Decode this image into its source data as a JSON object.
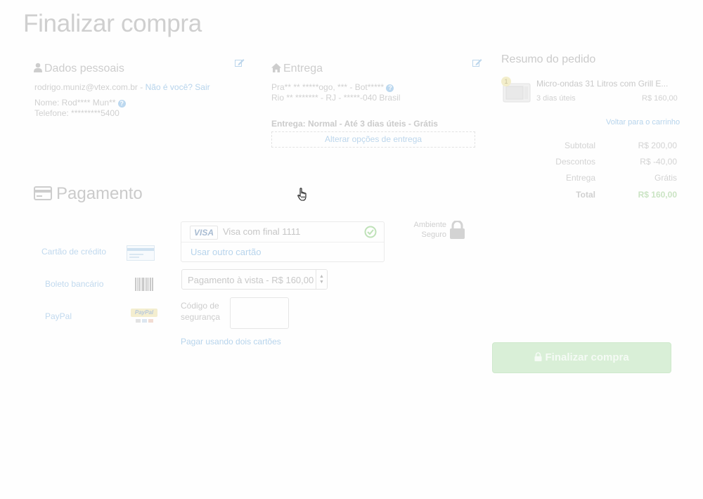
{
  "page": {
    "title": "Finalizar compra"
  },
  "personal": {
    "heading": "Dados pessoais",
    "email": "rodrigo.muniz@vtex.com.br",
    "separator": " - ",
    "not_you_link": "Não é você? Sair",
    "name_line": "Nome: Rod**** Mun**",
    "phone_line": "Telefone: *********5400"
  },
  "delivery": {
    "heading": "Entrega",
    "address_line1": "Pra** ** *****ogo, *** - Bot*****",
    "address_line2": "Rio ** ******* - RJ - *****-040 Brasil",
    "shipping_info": "Entrega: Normal - Até 3 dias úteis - Grátis",
    "change_options_button": "Alterar opções de entrega"
  },
  "summary": {
    "heading": "Resumo do pedido",
    "item": {
      "quantity_badge": "1",
      "name": "Micro-ondas 31 Litros com Grill E...",
      "delivery_time": "3 dias úteis",
      "price": "R$ 160,00"
    },
    "back_to_cart_link": "Voltar para o carrinho",
    "rows": [
      {
        "label": "Subtotal",
        "value": "R$ 200,00"
      },
      {
        "label": "Descontos",
        "value": "R$ -40,00"
      },
      {
        "label": "Entrega",
        "value": "Grátis"
      },
      {
        "label": "Total",
        "value": "R$ 160,00"
      }
    ]
  },
  "payment": {
    "heading": "Pagamento",
    "methods": [
      {
        "label": "Cartão de crédito",
        "icon": "credit-card-icon"
      },
      {
        "label": "Boleto bancário",
        "icon": "barcode-icon"
      },
      {
        "label": "PayPal",
        "icon": "paypal-icon"
      }
    ],
    "card": {
      "brand": "VISA",
      "saved_card_label": "Visa com final 1111",
      "use_other_card": "Usar outro cartão"
    },
    "installments_selected": "Pagamento à vista - R$ 160,00",
    "security_code_label": "Código de segurança",
    "two_cards_link": "Pagar usando dois cartões",
    "secure_label_line1": "Ambiente",
    "secure_label_line2": "Seguro",
    "paypal_logo_text": "PayPal"
  },
  "finish_button": "Finalizar compra",
  "colors": {
    "link": "#b7d4ec",
    "finish_button_bg": "#d9efd7",
    "total_value": "#cbe4c4",
    "check_green": "#bfe2b8"
  }
}
